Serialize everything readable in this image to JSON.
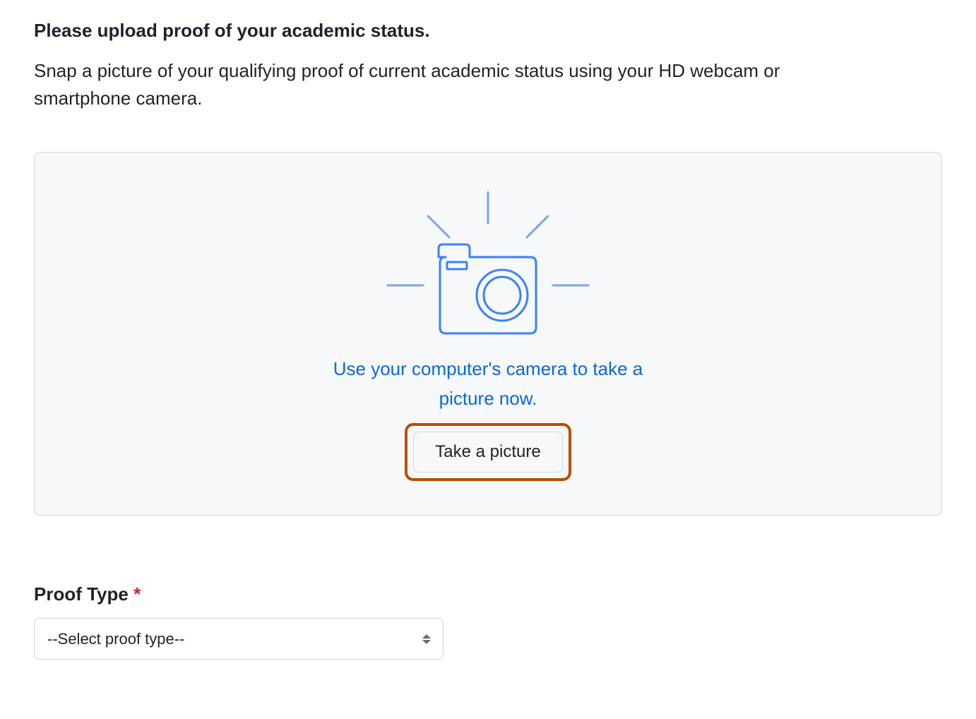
{
  "heading": "Please upload proof of your academic status.",
  "description": "Snap a picture of your qualifying proof of current academic status using your HD webcam or smartphone camera.",
  "upload": {
    "caption": "Use your computer's camera to take a picture now.",
    "button_label": "Take a picture"
  },
  "proof_type": {
    "label": "Proof Type",
    "required_mark": "*",
    "selected": "--Select proof type--"
  },
  "colors": {
    "accent": "#0969da",
    "highlight_border": "#bc4c00",
    "panel_bg": "#f6f8fa",
    "border": "#d0d7de",
    "required": "#cf222e"
  }
}
